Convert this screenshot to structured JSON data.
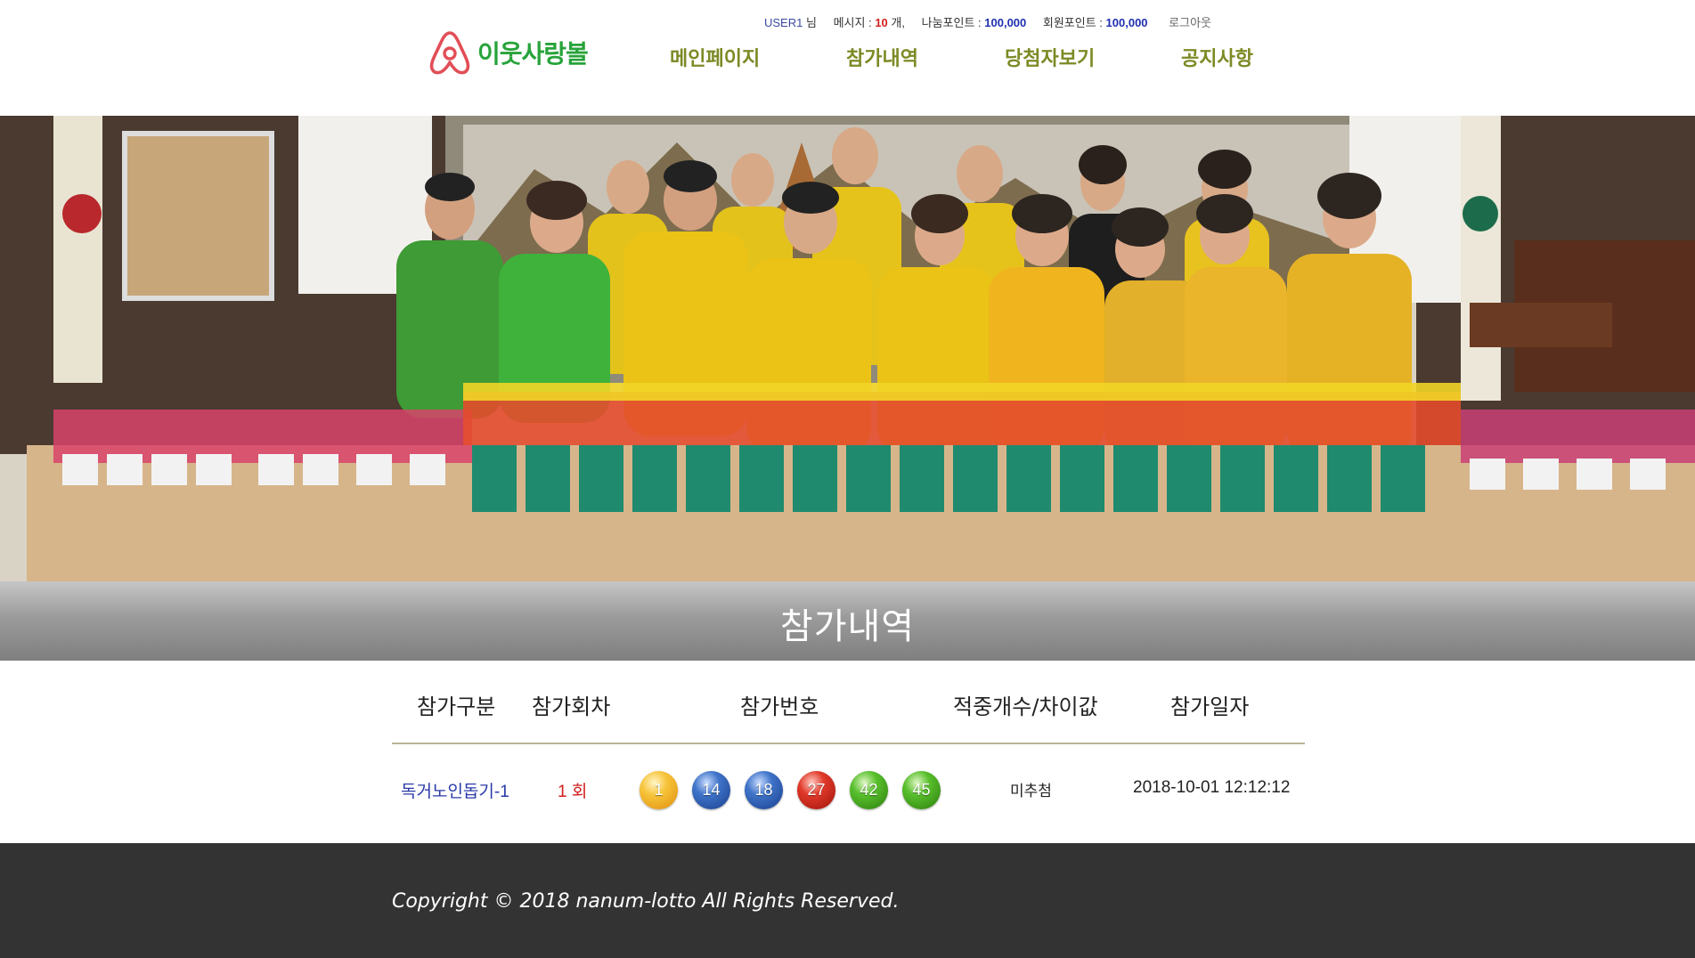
{
  "userbar": {
    "username": "USER1",
    "honorific": "님",
    "message_label": "메시지 :",
    "message_count": "10",
    "message_unit": "개,",
    "share_points_label": "나눔포인트 :",
    "share_points": "100,000",
    "member_points_label": "회원포인트 :",
    "member_points": "100,000",
    "logout": "로그아웃"
  },
  "brand": {
    "name": "이웃사랑볼",
    "logo_icon": "airbnb-style-logo-icon",
    "color": "#27a33a"
  },
  "nav": {
    "items": [
      {
        "label": "메인페이지"
      },
      {
        "label": "참가내역"
      },
      {
        "label": "당첨자보기"
      },
      {
        "label": "공지사항"
      }
    ],
    "color": "#7d8a25"
  },
  "hero": {
    "image": "group-photo-volunteers-with-flower-pots"
  },
  "page": {
    "title": "참가내역"
  },
  "table": {
    "headers": {
      "category": "참가구분",
      "round": "참가회차",
      "numbers": "참가번호",
      "match": "적중개수/차이값",
      "date": "참가일자"
    },
    "rows": [
      {
        "category": "독거노인돕기-1",
        "round": "1 회",
        "balls": [
          {
            "number": "1",
            "color": "yellow"
          },
          {
            "number": "14",
            "color": "blue"
          },
          {
            "number": "18",
            "color": "blue"
          },
          {
            "number": "27",
            "color": "red"
          },
          {
            "number": "42",
            "color": "green"
          },
          {
            "number": "45",
            "color": "green"
          }
        ],
        "result": "미추첨",
        "date": "2018-10-01 12:12:12"
      }
    ]
  },
  "footer": {
    "copyright": "Copyright © 2018 nanum-lotto All Rights Reserved."
  },
  "colors": {
    "footer_bg": "#333333",
    "link_blue": "#2a3aa8",
    "accent_red": "#d21f1f"
  }
}
